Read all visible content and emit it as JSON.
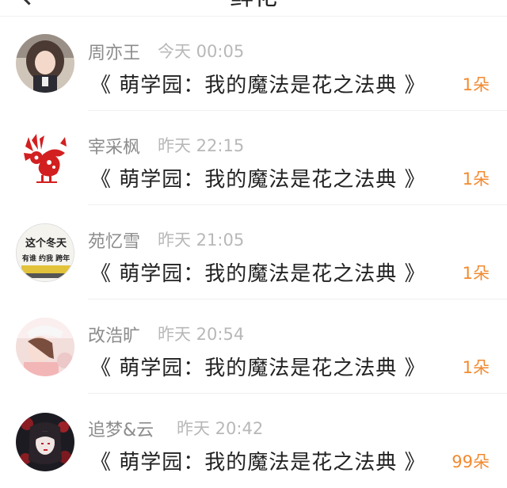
{
  "header": {
    "title": "鲜花"
  },
  "records": [
    {
      "name": "周亦王",
      "time": "今天 00:05",
      "book": "《 萌学园：我的魔法是花之法典 》",
      "amount": "1朵"
    },
    {
      "name": "宰采枫",
      "time": "昨天 22:15",
      "book": "《 萌学园：我的魔法是花之法典 》",
      "amount": "1朵"
    },
    {
      "name": "苑忆雪",
      "time": "昨天 21:05",
      "book": "《 萌学园：我的魔法是花之法典 》",
      "amount": "1朵",
      "avatar_text": [
        "这个冬天",
        "有谁 约我 跨年"
      ]
    },
    {
      "name": "改浩旷",
      "time": "昨天 20:54",
      "book": "《 萌学园：我的魔法是花之法典 》",
      "amount": "1朵"
    },
    {
      "name": "追梦&云",
      "time": "昨天 20:42",
      "book": "《 萌学园：我的魔法是花之法典 》",
      "amount": "99朵"
    }
  ],
  "colors": {
    "accent": "#f28a30",
    "name": "#8c8c8c",
    "time": "#b8b8b8",
    "text": "#222222"
  },
  "icons": [
    "back-arrow-icon"
  ]
}
